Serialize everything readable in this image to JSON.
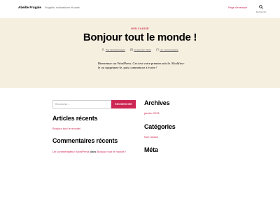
{
  "header": {
    "site_title": "Abeille Frugale",
    "site_description": "Frugalité, minimalisme et santé",
    "nav_link": "Page d'exemple",
    "search_label": "Recherche",
    "search_icon": "search-icon"
  },
  "post": {
    "category": "NON CLASSÉ",
    "title": "Bonjour tout le monde !",
    "author": "Par abeillefrugale",
    "date": "10 janvier 2021",
    "comments": "Un commentaire",
    "body": "Bienvenue sur WordPress. Ceci est votre premier article. Modifiez-le ou supprimez-le, puis commencez à écrire !"
  },
  "sidebar": {
    "search": {
      "placeholder": "Rechercher…",
      "button_label": "RECHERCHER"
    },
    "recent_posts": {
      "title": "Articles récents",
      "items": [
        "Bonjour tout le monde !"
      ]
    },
    "recent_comments": {
      "title": "Commentaires récents",
      "author": "Un commentateur WordPress",
      "connector": "dans",
      "post": "Bonjour tout le monde !"
    },
    "archives": {
      "title": "Archives",
      "items": [
        "janvier 2021"
      ]
    },
    "categories": {
      "title": "Catégories",
      "items": [
        "Non classé"
      ]
    },
    "meta": {
      "title": "Méta"
    }
  },
  "colors": {
    "accent": "#cd2653",
    "hero_background": "#f5efe0",
    "muted_text": "#6d6d6d"
  }
}
